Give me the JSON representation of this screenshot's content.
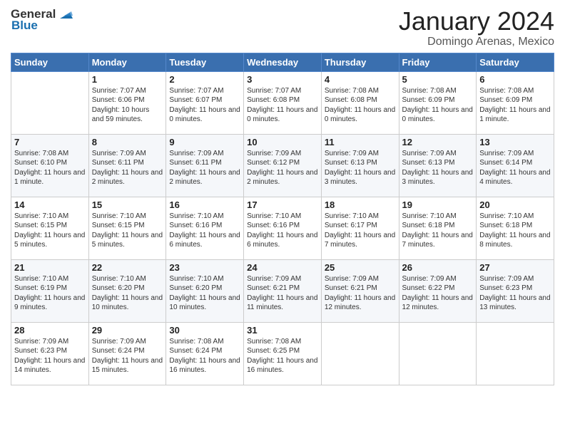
{
  "logo": {
    "general": "General",
    "blue": "Blue"
  },
  "title": "January 2024",
  "location": "Domingo Arenas, Mexico",
  "days_header": [
    "Sunday",
    "Monday",
    "Tuesday",
    "Wednesday",
    "Thursday",
    "Friday",
    "Saturday"
  ],
  "weeks": [
    [
      {
        "day": "",
        "info": ""
      },
      {
        "day": "1",
        "info": "Sunrise: 7:07 AM\nSunset: 6:06 PM\nDaylight: 10 hours\nand 59 minutes."
      },
      {
        "day": "2",
        "info": "Sunrise: 7:07 AM\nSunset: 6:07 PM\nDaylight: 11 hours\nand 0 minutes."
      },
      {
        "day": "3",
        "info": "Sunrise: 7:07 AM\nSunset: 6:08 PM\nDaylight: 11 hours\nand 0 minutes."
      },
      {
        "day": "4",
        "info": "Sunrise: 7:08 AM\nSunset: 6:08 PM\nDaylight: 11 hours\nand 0 minutes."
      },
      {
        "day": "5",
        "info": "Sunrise: 7:08 AM\nSunset: 6:09 PM\nDaylight: 11 hours\nand 0 minutes."
      },
      {
        "day": "6",
        "info": "Sunrise: 7:08 AM\nSunset: 6:09 PM\nDaylight: 11 hours\nand 1 minute."
      }
    ],
    [
      {
        "day": "7",
        "info": "Sunrise: 7:08 AM\nSunset: 6:10 PM\nDaylight: 11 hours\nand 1 minute."
      },
      {
        "day": "8",
        "info": "Sunrise: 7:09 AM\nSunset: 6:11 PM\nDaylight: 11 hours\nand 2 minutes."
      },
      {
        "day": "9",
        "info": "Sunrise: 7:09 AM\nSunset: 6:11 PM\nDaylight: 11 hours\nand 2 minutes."
      },
      {
        "day": "10",
        "info": "Sunrise: 7:09 AM\nSunset: 6:12 PM\nDaylight: 11 hours\nand 2 minutes."
      },
      {
        "day": "11",
        "info": "Sunrise: 7:09 AM\nSunset: 6:13 PM\nDaylight: 11 hours\nand 3 minutes."
      },
      {
        "day": "12",
        "info": "Sunrise: 7:09 AM\nSunset: 6:13 PM\nDaylight: 11 hours\nand 3 minutes."
      },
      {
        "day": "13",
        "info": "Sunrise: 7:09 AM\nSunset: 6:14 PM\nDaylight: 11 hours\nand 4 minutes."
      }
    ],
    [
      {
        "day": "14",
        "info": "Sunrise: 7:10 AM\nSunset: 6:15 PM\nDaylight: 11 hours\nand 5 minutes."
      },
      {
        "day": "15",
        "info": "Sunrise: 7:10 AM\nSunset: 6:15 PM\nDaylight: 11 hours\nand 5 minutes."
      },
      {
        "day": "16",
        "info": "Sunrise: 7:10 AM\nSunset: 6:16 PM\nDaylight: 11 hours\nand 6 minutes."
      },
      {
        "day": "17",
        "info": "Sunrise: 7:10 AM\nSunset: 6:16 PM\nDaylight: 11 hours\nand 6 minutes."
      },
      {
        "day": "18",
        "info": "Sunrise: 7:10 AM\nSunset: 6:17 PM\nDaylight: 11 hours\nand 7 minutes."
      },
      {
        "day": "19",
        "info": "Sunrise: 7:10 AM\nSunset: 6:18 PM\nDaylight: 11 hours\nand 7 minutes."
      },
      {
        "day": "20",
        "info": "Sunrise: 7:10 AM\nSunset: 6:18 PM\nDaylight: 11 hours\nand 8 minutes."
      }
    ],
    [
      {
        "day": "21",
        "info": "Sunrise: 7:10 AM\nSunset: 6:19 PM\nDaylight: 11 hours\nand 9 minutes."
      },
      {
        "day": "22",
        "info": "Sunrise: 7:10 AM\nSunset: 6:20 PM\nDaylight: 11 hours\nand 10 minutes."
      },
      {
        "day": "23",
        "info": "Sunrise: 7:10 AM\nSunset: 6:20 PM\nDaylight: 11 hours\nand 10 minutes."
      },
      {
        "day": "24",
        "info": "Sunrise: 7:09 AM\nSunset: 6:21 PM\nDaylight: 11 hours\nand 11 minutes."
      },
      {
        "day": "25",
        "info": "Sunrise: 7:09 AM\nSunset: 6:21 PM\nDaylight: 11 hours\nand 12 minutes."
      },
      {
        "day": "26",
        "info": "Sunrise: 7:09 AM\nSunset: 6:22 PM\nDaylight: 11 hours\nand 12 minutes."
      },
      {
        "day": "27",
        "info": "Sunrise: 7:09 AM\nSunset: 6:23 PM\nDaylight: 11 hours\nand 13 minutes."
      }
    ],
    [
      {
        "day": "28",
        "info": "Sunrise: 7:09 AM\nSunset: 6:23 PM\nDaylight: 11 hours\nand 14 minutes."
      },
      {
        "day": "29",
        "info": "Sunrise: 7:09 AM\nSunset: 6:24 PM\nDaylight: 11 hours\nand 15 minutes."
      },
      {
        "day": "30",
        "info": "Sunrise: 7:08 AM\nSunset: 6:24 PM\nDaylight: 11 hours\nand 16 minutes."
      },
      {
        "day": "31",
        "info": "Sunrise: 7:08 AM\nSunset: 6:25 PM\nDaylight: 11 hours\nand 16 minutes."
      },
      {
        "day": "",
        "info": ""
      },
      {
        "day": "",
        "info": ""
      },
      {
        "day": "",
        "info": ""
      }
    ]
  ]
}
